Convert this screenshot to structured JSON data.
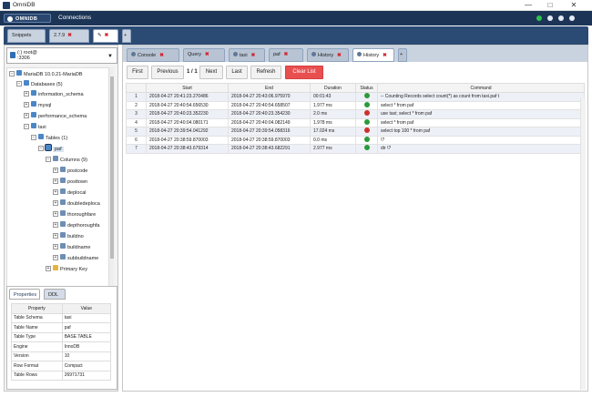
{
  "window": {
    "title": "OmniDB"
  },
  "topbar": {
    "brand": "OMNIDB",
    "section": "Connections"
  },
  "outer_tabs": [
    {
      "label": "Snippets"
    },
    {
      "label": "2.7.9"
    },
    {
      "label": ""
    }
  ],
  "connection": {
    "label": "(:) root@",
    "label2": ":3306"
  },
  "tree": {
    "server": "MariaDB 10.0.21-MariaDB",
    "databases": "Databases (5)",
    "db1": "information_schema",
    "db2": "mysql",
    "db3": "performance_schema",
    "db4": "taxi",
    "tables": "Tables (1)",
    "table1": "paf",
    "columns": "Columns (9)",
    "col1": "postcode",
    "col2": "posttown",
    "col3": "deplocal",
    "col4": "doubledeploca",
    "col5": "thoroughfare",
    "col6": "depthoroughfa",
    "col7": "buildno",
    "col8": "buildname",
    "col9": "subbuildname",
    "pk": "Primary Key"
  },
  "props": {
    "tabs": [
      "Properties",
      "DDL"
    ],
    "headers": [
      "Property",
      "Value"
    ],
    "rows": [
      [
        "Table Schema",
        "taxi"
      ],
      [
        "Table Name",
        "paf"
      ],
      [
        "Table Type",
        "BASE TABLE"
      ],
      [
        "Engine",
        "InnoDB"
      ],
      [
        "Version",
        "10"
      ],
      [
        "Row Format",
        "Compact"
      ],
      [
        "Table Rows",
        "26971731"
      ]
    ]
  },
  "inner_tabs": [
    {
      "label": "Console"
    },
    {
      "label": "Query"
    },
    {
      "label": "taxi"
    },
    {
      "label": "paf"
    },
    {
      "label": "History"
    },
    {
      "label": "History"
    }
  ],
  "toolbar": {
    "first": "First",
    "previous": "Previous",
    "page": "1 / 1",
    "next": "Next",
    "last": "Last",
    "refresh": "Refresh",
    "clear": "Clear List"
  },
  "history": {
    "headers": [
      "",
      "Start",
      "End",
      "Duration",
      "Status",
      "Command"
    ],
    "rows": [
      [
        "1",
        "2018-04-27 20:41:23.270486",
        "2018-04-27 20:43:06.975970",
        "00:01:43",
        "ok",
        "-- Counting Records select count(*) as count from taxi.paf t"
      ],
      [
        "2",
        "2018-04-27 20:40:54.656530",
        "2018-04-27 20:40:54.658507",
        "1.977 ms",
        "ok",
        "select * from paf"
      ],
      [
        "3",
        "2018-04-27 20:40:23.352230",
        "2018-04-27 20:40:23.354230",
        "2.0 ms",
        "err",
        "use taxi; select * from paf"
      ],
      [
        "4",
        "2018-04-27 20:40:04.080171",
        "2018-04-27 20:40:04.082149",
        "1.978 ms",
        "ok",
        "select * from paf"
      ],
      [
        "5",
        "2018-04-27 20:39:54.041292",
        "2018-04-27 20:39:54.058316",
        "17.024 ms",
        "err",
        "select top 100 * from paf"
      ],
      [
        "6",
        "2018-04-27 20:38:59.870003",
        "2018-04-27 20:38:59.870003",
        "0.0 ms",
        "ok",
        "\\?"
      ],
      [
        "7",
        "2018-04-27 20:38:43.679314",
        "2018-04-27 20:38:43.682291",
        "2.977 ms",
        "ok",
        "dir \\?"
      ]
    ]
  },
  "colors": {
    "topbar": "#1c3557",
    "danger": "#e84f4f",
    "ok": "#2b9a3b",
    "err": "#d0302a"
  }
}
